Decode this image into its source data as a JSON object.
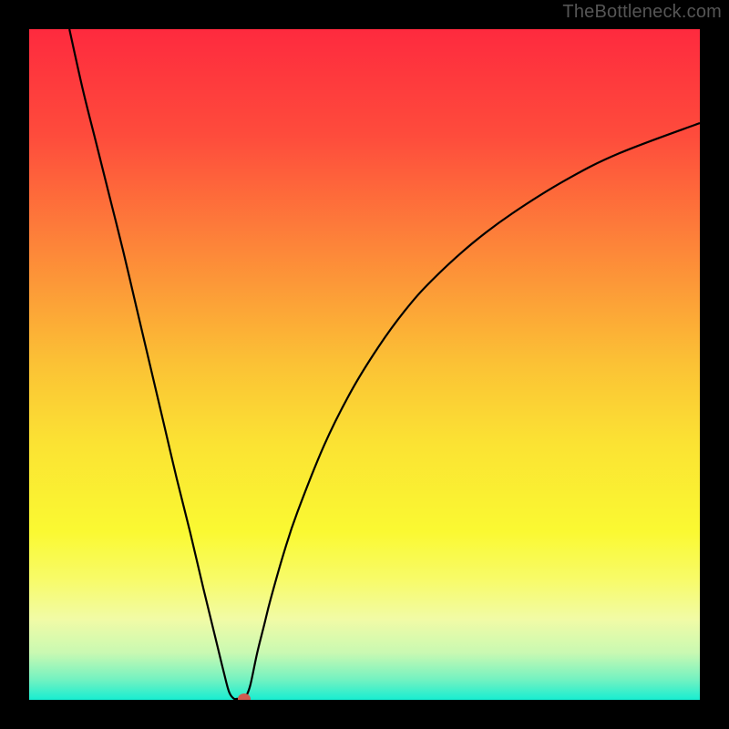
{
  "watermark": "TheBottleneck.com",
  "chart_data": {
    "type": "line",
    "title": "",
    "xlabel": "",
    "ylabel": "",
    "xlim": [
      0,
      100
    ],
    "ylim": [
      0,
      100
    ],
    "grid": false,
    "legend": false,
    "background_gradient": {
      "stops": [
        {
          "pos": 0,
          "color": "#fe2a3e"
        },
        {
          "pos": 0.16,
          "color": "#fe4c3c"
        },
        {
          "pos": 0.33,
          "color": "#fd8739"
        },
        {
          "pos": 0.5,
          "color": "#fbc235"
        },
        {
          "pos": 0.62,
          "color": "#fbe333"
        },
        {
          "pos": 0.75,
          "color": "#faf932"
        },
        {
          "pos": 0.82,
          "color": "#f8fb68"
        },
        {
          "pos": 0.88,
          "color": "#f1fba6"
        },
        {
          "pos": 0.93,
          "color": "#c9f9b2"
        },
        {
          "pos": 0.97,
          "color": "#73f2c1"
        },
        {
          "pos": 1.0,
          "color": "#17edd1"
        }
      ]
    },
    "series": [
      {
        "name": "bottleneck-curve",
        "color": "#000000",
        "x": [
          6,
          8,
          10,
          12,
          14,
          16,
          18,
          20,
          22,
          24,
          26,
          28,
          29,
          29.8,
          30.5,
          31,
          31.5,
          32,
          32.4,
          33,
          34,
          35,
          36,
          38,
          40,
          44,
          48,
          52,
          56,
          60,
          66,
          72,
          80,
          88,
          100
        ],
        "y": [
          100,
          91,
          83,
          75,
          67,
          58.5,
          50,
          41.5,
          33,
          25,
          16.5,
          8.3,
          4.2,
          1.2,
          0.2,
          0.15,
          0.15,
          0.15,
          0.65,
          2.3,
          7,
          11,
          15,
          22,
          28,
          38,
          46,
          52.5,
          58,
          62.5,
          68,
          72.5,
          77.5,
          81.5,
          86
        ]
      }
    ],
    "marker": {
      "x": 32,
      "y": 0.2,
      "color": "#cf5a50"
    }
  }
}
